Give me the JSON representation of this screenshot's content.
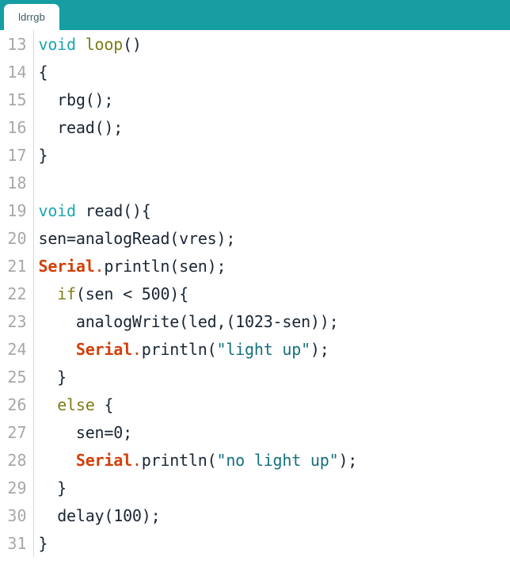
{
  "window": {
    "header_color": "#169ea3",
    "background_color": "#ffffff"
  },
  "tabbar": {
    "tabs": [
      {
        "label": "ldrrgb",
        "active": true
      }
    ]
  },
  "editor": {
    "language": "arduino",
    "first_line_number": 13,
    "last_line_number": 31,
    "token_colors": {
      "plain": "#1a2633",
      "type": "#1aa7b4",
      "keyword": "#7d7c15",
      "function": "#e8601c",
      "object": "#d14009",
      "string": "#14707d",
      "line_number": "#a8a8a8"
    },
    "lines": [
      {
        "num": "13",
        "tokens": [
          {
            "t": "void",
            "c": "type"
          },
          {
            "t": " ",
            "c": "plain"
          },
          {
            "t": "loop",
            "c": "keyword"
          },
          {
            "t": "()",
            "c": "plain"
          }
        ]
      },
      {
        "num": "14",
        "tokens": [
          {
            "t": "{",
            "c": "plain"
          }
        ]
      },
      {
        "num": "15",
        "tokens": [
          {
            "t": "  rbg();",
            "c": "plain"
          }
        ]
      },
      {
        "num": "16",
        "tokens": [
          {
            "t": "  ",
            "c": "plain"
          },
          {
            "t": "read",
            "c": "function"
          },
          {
            "t": "();",
            "c": "plain"
          }
        ]
      },
      {
        "num": "17",
        "tokens": [
          {
            "t": "}",
            "c": "plain"
          }
        ]
      },
      {
        "num": "18",
        "tokens": [
          {
            "t": "",
            "c": "plain"
          }
        ]
      },
      {
        "num": "19",
        "tokens": [
          {
            "t": "void",
            "c": "type"
          },
          {
            "t": " ",
            "c": "plain"
          },
          {
            "t": "read",
            "c": "function"
          },
          {
            "t": "(){",
            "c": "plain"
          }
        ]
      },
      {
        "num": "20",
        "tokens": [
          {
            "t": "sen=",
            "c": "plain"
          },
          {
            "t": "analogRead",
            "c": "function"
          },
          {
            "t": "(vres);",
            "c": "plain"
          }
        ]
      },
      {
        "num": "21",
        "tokens": [
          {
            "t": "Serial",
            "c": "object"
          },
          {
            "t": ".",
            "c": "dot"
          },
          {
            "t": "println",
            "c": "function"
          },
          {
            "t": "(sen);",
            "c": "plain"
          }
        ]
      },
      {
        "num": "22",
        "tokens": [
          {
            "t": "  ",
            "c": "plain"
          },
          {
            "t": "if",
            "c": "keyword"
          },
          {
            "t": "(sen < 500){",
            "c": "plain"
          }
        ]
      },
      {
        "num": "23",
        "tokens": [
          {
            "t": "    ",
            "c": "plain"
          },
          {
            "t": "analogWrite",
            "c": "function"
          },
          {
            "t": "(led,(1023-sen));",
            "c": "plain"
          }
        ]
      },
      {
        "num": "24",
        "tokens": [
          {
            "t": "    ",
            "c": "plain"
          },
          {
            "t": "Serial",
            "c": "object"
          },
          {
            "t": ".",
            "c": "dot"
          },
          {
            "t": "println",
            "c": "function"
          },
          {
            "t": "(",
            "c": "plain"
          },
          {
            "t": "\"light up\"",
            "c": "string"
          },
          {
            "t": ");",
            "c": "plain"
          }
        ]
      },
      {
        "num": "25",
        "tokens": [
          {
            "t": "  }",
            "c": "plain"
          }
        ]
      },
      {
        "num": "26",
        "tokens": [
          {
            "t": "  ",
            "c": "plain"
          },
          {
            "t": "else",
            "c": "keyword"
          },
          {
            "t": " {",
            "c": "plain"
          }
        ]
      },
      {
        "num": "27",
        "tokens": [
          {
            "t": "    sen=0;",
            "c": "plain"
          }
        ]
      },
      {
        "num": "28",
        "tokens": [
          {
            "t": "    ",
            "c": "plain"
          },
          {
            "t": "Serial",
            "c": "object"
          },
          {
            "t": ".",
            "c": "dot"
          },
          {
            "t": "println",
            "c": "function"
          },
          {
            "t": "(",
            "c": "plain"
          },
          {
            "t": "\"no light up\"",
            "c": "string"
          },
          {
            "t": ");",
            "c": "plain"
          }
        ]
      },
      {
        "num": "29",
        "tokens": [
          {
            "t": "  }",
            "c": "plain"
          }
        ]
      },
      {
        "num": "30",
        "tokens": [
          {
            "t": "  ",
            "c": "plain"
          },
          {
            "t": "delay",
            "c": "function"
          },
          {
            "t": "(100);",
            "c": "plain"
          }
        ]
      },
      {
        "num": "31",
        "tokens": [
          {
            "t": "}",
            "c": "plain"
          }
        ]
      }
    ]
  }
}
